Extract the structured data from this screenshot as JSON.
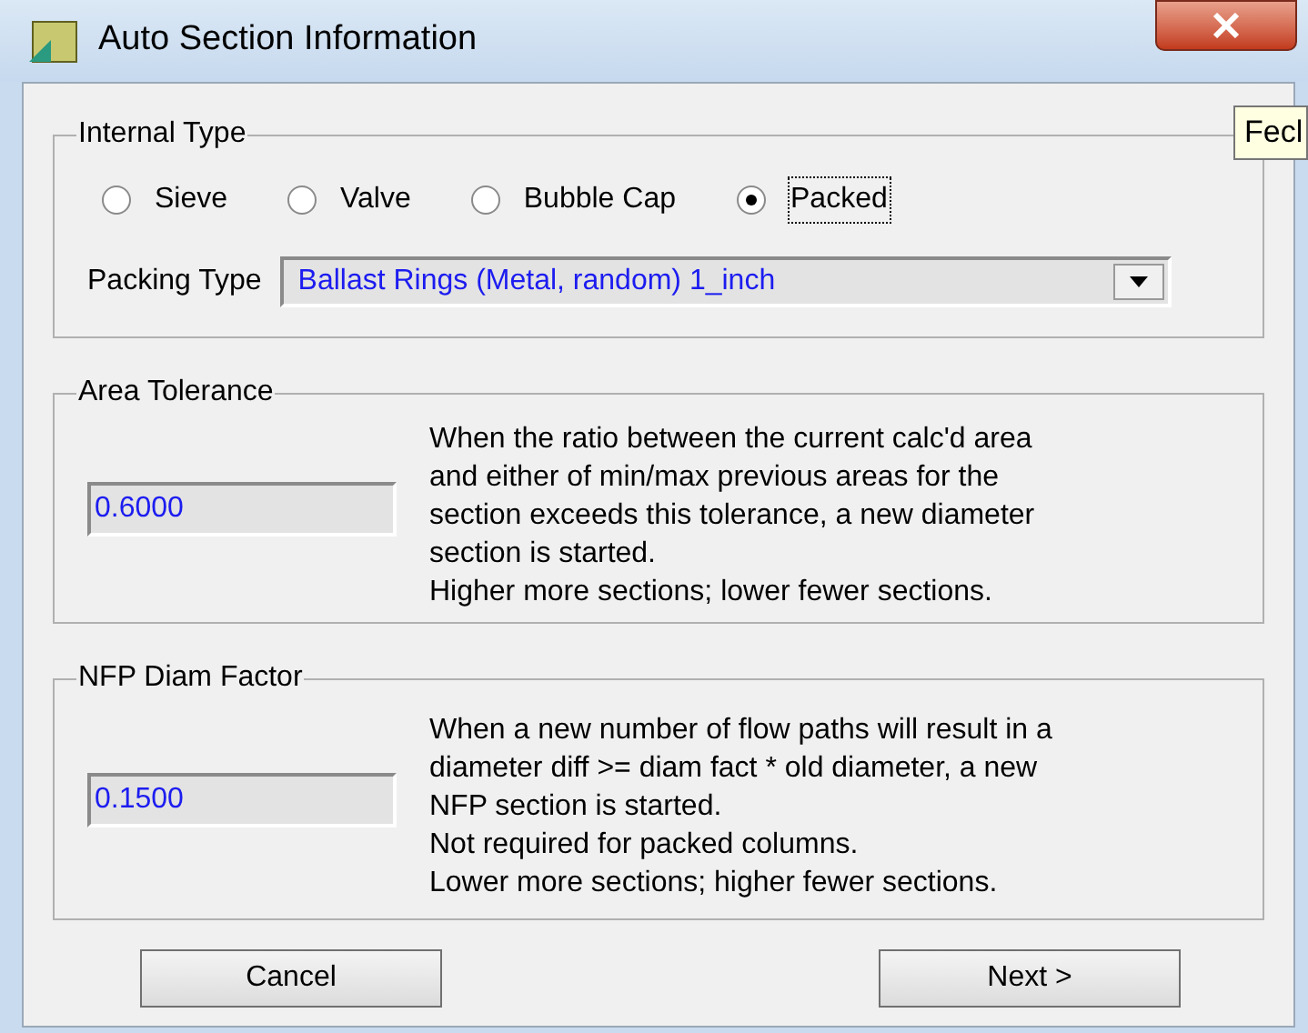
{
  "window": {
    "title": "Auto Section Information"
  },
  "tooltip": {
    "text": "Fecl"
  },
  "internal_type": {
    "label": "Internal Type",
    "options": [
      {
        "label": "Sieve",
        "selected": false
      },
      {
        "label": "Valve",
        "selected": false
      },
      {
        "label": "Bubble Cap",
        "selected": false
      },
      {
        "label": "Packed",
        "selected": true
      }
    ],
    "packing_type": {
      "label": "Packing Type",
      "value": "Ballast Rings (Metal, random) 1_inch"
    }
  },
  "groups": [
    {
      "label": "Area Tolerance",
      "value": "0.6000",
      "description": [
        "When the ratio between the current calc'd area",
        "and either of min/max previous areas for the",
        "section exceeds this tolerance, a new diameter",
        "section is started.",
        "Higher more sections; lower fewer sections."
      ]
    },
    {
      "label": "NFP Diam Factor",
      "value": "0.1500",
      "description": [
        "When a new number of flow paths will result in a",
        "diameter diff >= diam fact * old diameter, a new",
        "NFP section is started.",
        "Not required for packed columns.",
        "Lower more sections; higher fewer sections."
      ]
    }
  ],
  "buttons": [
    "Cancel",
    "Next >"
  ]
}
